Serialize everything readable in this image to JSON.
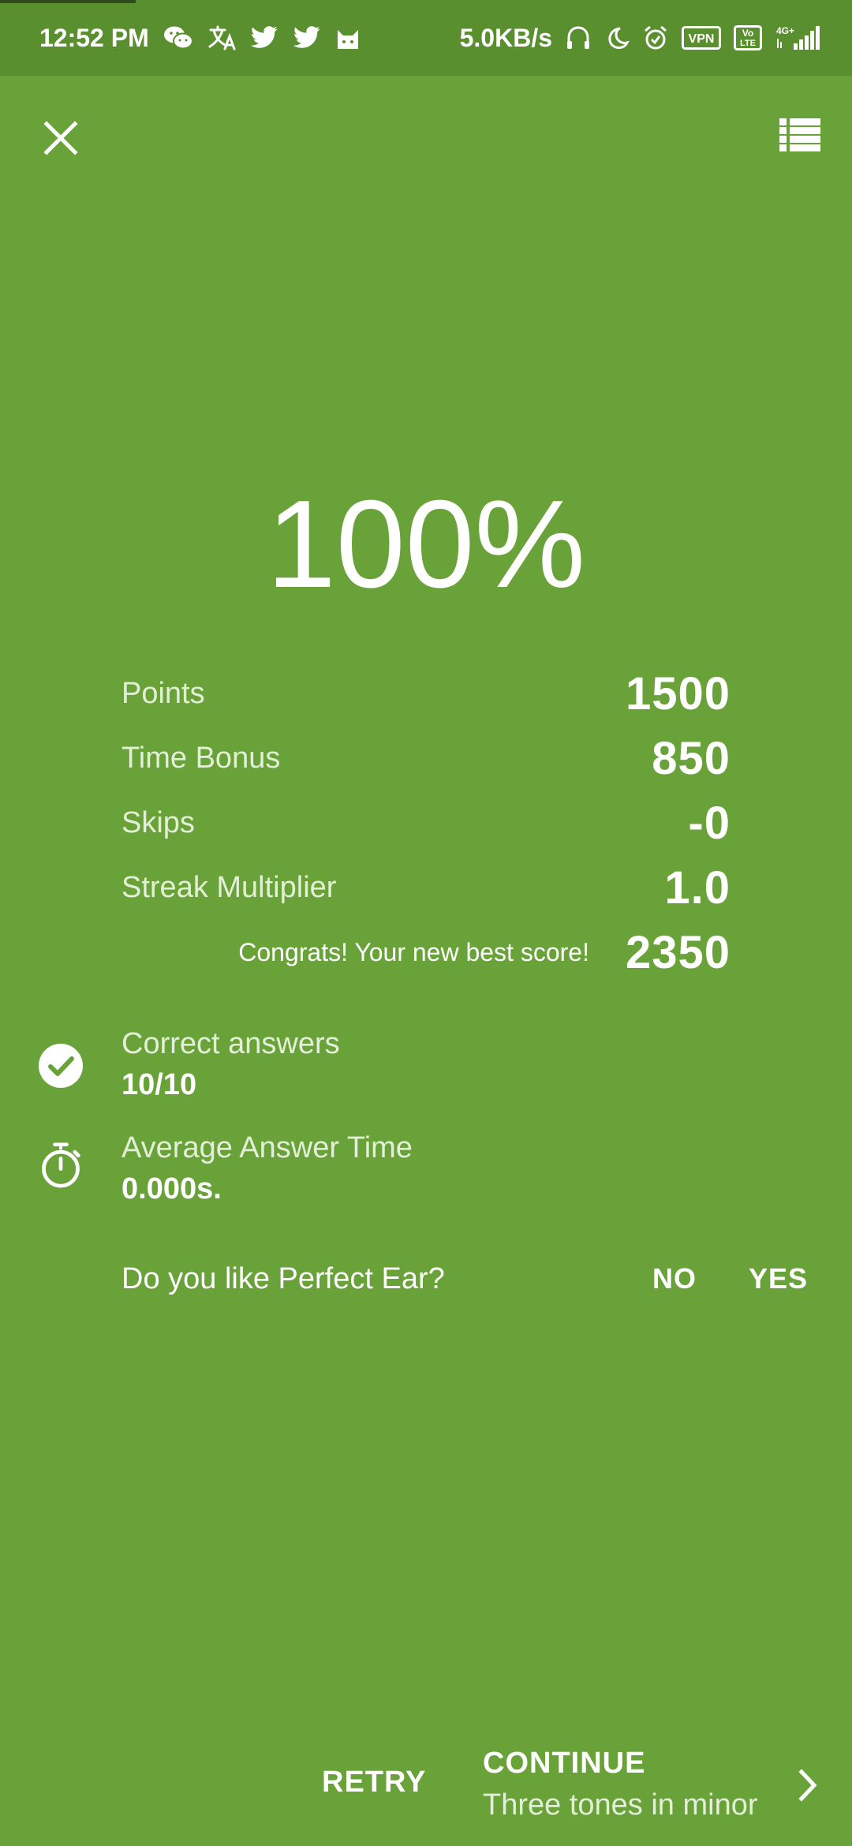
{
  "status_bar": {
    "time": "12:52 PM",
    "net_speed": "5.0KB/s",
    "vpn": "VPN",
    "volte_top": "Vo",
    "volte_bottom": "LTE",
    "network": "4G+"
  },
  "result": {
    "percent": "100%"
  },
  "score": {
    "rows": [
      {
        "label": "Points",
        "value": "1500"
      },
      {
        "label": "Time Bonus",
        "value": "850"
      },
      {
        "label": "Skips",
        "value": "-0"
      },
      {
        "label": "Streak Multiplier",
        "value": "1.0"
      }
    ],
    "congrats": "Congrats! Your new best score!",
    "total": "2350"
  },
  "stats": {
    "correct_label": "Correct answers",
    "correct_value": "10/10",
    "time_label": "Average Answer Time",
    "time_value": "0.000s."
  },
  "rating": {
    "question": "Do you like Perfect Ear?",
    "no": "NO",
    "yes": "YES"
  },
  "bottom": {
    "retry": "RETRY",
    "continue": "CONTINUE",
    "next_exercise": "Three tones in minor"
  },
  "colors": {
    "background": "#6aa23a",
    "status_bar": "#5a8f2f"
  }
}
